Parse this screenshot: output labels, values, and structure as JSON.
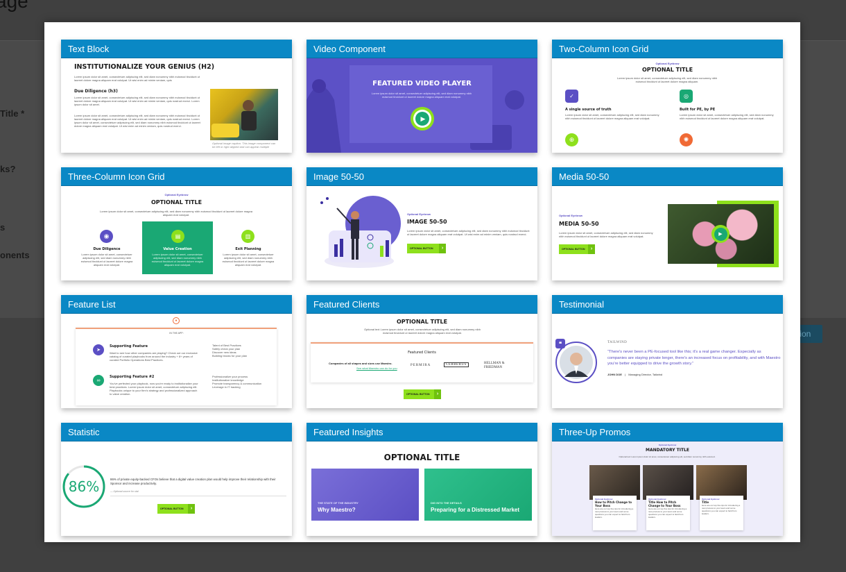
{
  "background": {
    "heading": "age",
    "label_title": "Title *",
    "label_q": "ks?",
    "label_s": "s",
    "label_components": "onents",
    "btn_fragment": "tion"
  },
  "cards": [
    {
      "title": "Text Block",
      "heading": "INSTITUTIONALIZE  YOUR GENIUS (H2)",
      "subheading": "Due Diligence (h3)",
      "para1": "Lorem ipsum dolor sit amet, consectetuer adipiscing elit, sed diam nonummy nibh euismod tincidunt ut laoreet dolore magna aliquam erat volutpat. Ut wisi enim ad minim veniam, quis",
      "para2": "Lorem ipsum dolor sit amet, consectetuer adipiscing elit, sed diam nonummy nibh euismod tincidunt ut laoreet dolore magna aliquam erat volutpat. Ut wisi enim ad minim veniam, quis nostrud exerci. Lorem ipsum dolor sit amet.",
      "para3": "Lorem ipsum dolor sit amet, consectetuer adipiscing elit, sed diam nonummy nibh euismod tincidunt ut laoreet dolore magna aliquam erat volutpat. Ut wisi enim ad minim veniam, quis nostrud exerci. Lorem ipsum dolor sit amet, consectetuer adipiscing elit, sed diam nonummy nibh euismod tincidunt ut laoreet dolore magna aliquam erat volutpat. Ut wisi enim ad minim veniam, quis nostrud exerci.",
      "caption": "Optional image caption. This image component can be left or right aligned and can appear multiple"
    },
    {
      "title": "Video Component",
      "heading": "FEATURED VIDEO PLAYER",
      "text": "Lorem ipsum dolor sit amet, consectetuer adipiscing elit, sed diam nonummy nibh euismod tincidunt ut laoreet dolore magna aliquam erat volutpat."
    },
    {
      "title": "Two-Column Icon Grid",
      "eyebrow": "Optional Eyebrow",
      "heading": "OPTIONAL TITLE",
      "intro": "Lorem ipsum dolor sit amet, consectetuer adipiscing elit, sed diam nonummy nibh euismod tincidunt ut laoreet dolore magna aliquam.",
      "item1_title": "A single source of truth",
      "item1_text": "Lorem ipsum dolor sit amet, consectetuer adipiscing elit, sed diam nonummy nibh euismod tincidunt ut laoreet dolore magna aliquam erat volutpat.",
      "item2_title": "Built for PE, by PE",
      "item2_text": "Lorem ipsum dolor sit amet, consectetuer adipiscing elit, sed diam nonummy nibh euismod tincidunt ut laoreet dolore magna aliquam erat volutpat."
    },
    {
      "title": "Three-Column Icon Grid",
      "eyebrow": "Optional Eyebrow",
      "heading": "OPTIONAL TITLE",
      "intro": "Lorem ipsum dolor sit amet, consectetuer adipiscing elit, sed diam nonummy nibh euismod tincidunt ut laoreet dolore magna aliquam erat volutpat.",
      "col1_title": "Due Diligence",
      "col2_title": "Value Creation",
      "col3_title": "Exit Planning",
      "col_text": "Lorem ipsum dolor sit amet, consectetuer adipiscing elit, sed diam nonummy nibh euismod tincidunt ut laoreet dolore magna aliquam erat volutpat."
    },
    {
      "title": "Image 50-50",
      "eyebrow": "Optional Eyebrow",
      "heading": "IMAGE 50-50",
      "text": "Lorem ipsum dolor sit amet, consectetuer adipiscing elit, sed diam nonummy nibh euismod tincidunt ut laoreet dolore magna aliquam erat volutpat. Ut wisi enim ad minim veniam, quis nostrud exerci.",
      "button": "OPTIONAL BUTTON"
    },
    {
      "title": "Media 50-50",
      "eyebrow": "Optional Eyebrow",
      "heading": "MEDIA 50-50",
      "text": "Lorem ipsum dolor sit amet, consectetuer adipiscing elit, sed diam nonummy nibh euismod tincidunt ut laoreet dolore magna aliquam erat volutpat.",
      "button": "OPTIONAL BUTTON"
    },
    {
      "title": "Feature List",
      "label": "IN THE APP:",
      "f1_title": "Supporting Feature",
      "f1_text": "Want to see how other companies are playing? Check out our exclusive catalog of curated playbooks from around the industry + 8+ years of curated Portfolio Operations Best Practices.",
      "f2_title": "Supporting Feature #2",
      "f2_text": "You've perfected your playbook, now you're ready to institutionalize your best practices. Lorem ipsum dolor sit amet, consectetuer adipiscing elit. Playbooks unique to your firm's strategy and professionalized approach to value creation.",
      "list1": [
        "Talent of Best Practices",
        "Safely check your plan",
        "Discover new ideas",
        "Building blocks for your plan"
      ],
      "list2": [
        "Professionalize your process",
        "Institutionalize knowledge",
        "Promote transparency & communication",
        "Leverage in IT tracking"
      ]
    },
    {
      "title": "Featured Clients",
      "heading": "OPTIONAL TITLE",
      "intro": "Optional text Lorem ipsum dolor sit amet, consectetuer adipiscing elit, sed diam nonummy nibh euismod tincidunt ut laoreet dolore magna aliquam erat volutpat.",
      "sub": "Featured Clients",
      "left_text": "Companies of all shapes and sizes use Maestro.",
      "link": "See what Maestro can do for you",
      "logos": [
        "PERMIRA",
        "CERBERUS",
        "HELLMAN & FRIEDMAN"
      ],
      "button": "OPTIONAL BUTTON"
    },
    {
      "title": "Testimonial",
      "brand": "TAILWIND",
      "quote": "“There's never been a PE-focused tool like this; it's a real game changer. Especially as companies are staying private longer, there's an increased focus on profitability, and with Maestro you're better equipped to drive the growth story.”",
      "name": "JOHN DOE",
      "role": "Managing Director, Tailwind"
    },
    {
      "title": "Statistic",
      "value": "86%",
      "value_fraction": 0.86,
      "text": "86% of private equity-backed CFOs believe that a digital value creation plan would help improve their relationship with their Sponsor and increase productivity.",
      "source": "— Optional source for stat",
      "button": "OPTIONAL BUTTON"
    },
    {
      "title": "Featured Insights",
      "heading": "OPTIONAL TITLE",
      "tile1_eyebrow": "THE STATE OF THE INDUSTRY",
      "tile1_title": "Why Maestro?",
      "tile2_eyebrow": "DIG INTO THE DETAILS",
      "tile2_title": "Preparing for a Distressed Market"
    },
    {
      "title": "Three-Up Promos",
      "eyebrow": "Optional Eyebrow",
      "heading": "MANDATORY TITLE",
      "intro": "Optional text Lorem ipsum dolor sit amet, consectetuer adipiscing elit, sed diam nonummy nibh euismod.",
      "promo_eyebrow": "Optional Eyebrow",
      "promo1": "How to Pitch Change to Your Boss",
      "promo2": "Title How to Pitch Change to Your Boss",
      "promo3": "Title",
      "promo_text": "Here are our top five tips for introducing a new process to your team and some questions you can expect to field from leaders."
    }
  ],
  "colors": {
    "header_blue": "#0a88c5",
    "brand_purple": "#5b4fc4",
    "brand_green": "#1aa874",
    "lime": "#8ee01c",
    "orange": "#f06a35"
  }
}
